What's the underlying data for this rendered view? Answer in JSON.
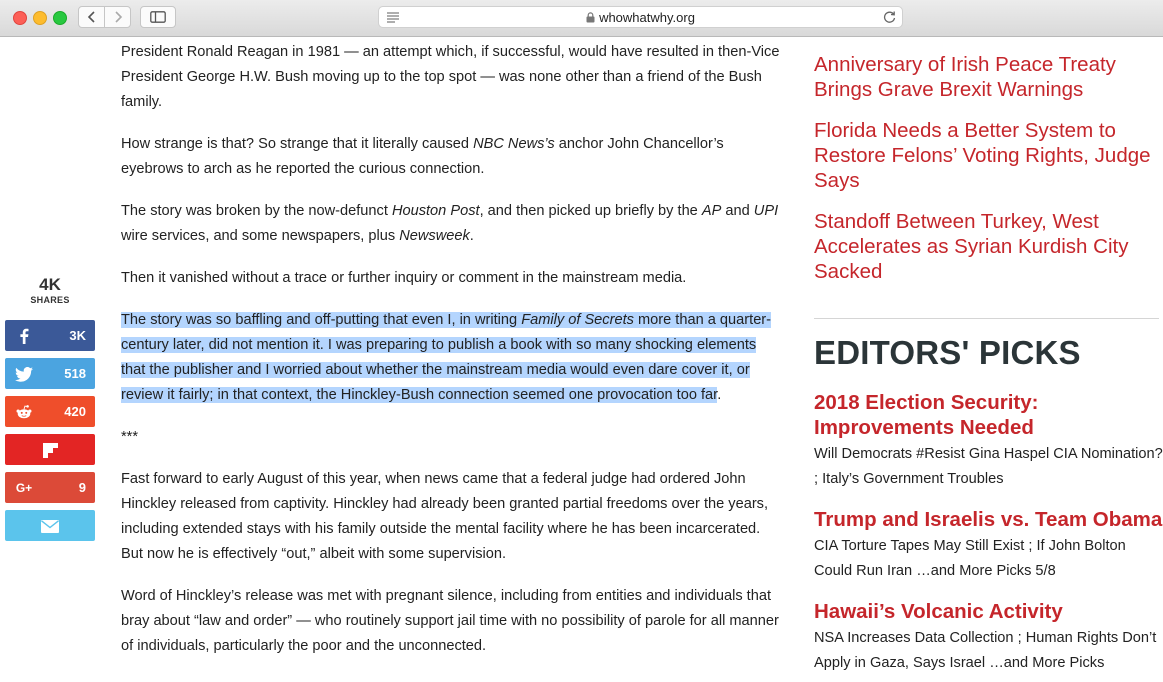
{
  "browser": {
    "url": "whowhatwhy.org"
  },
  "article": {
    "paragraphs": [
      {
        "runs": [
          {
            "t": "President Ronald Reagan in 1981 — an attempt which, if successful, would have resulted in then-Vice President George H.W. Bush moving up to the top spot — was none other than a friend of the Bush family."
          }
        ]
      },
      {
        "runs": [
          {
            "t": "How strange is that? So strange that it literally caused "
          },
          {
            "t": "NBC News’s",
            "i": true
          },
          {
            "t": " anchor John Chancellor’s eyebrows to arch as he reported the curious connection."
          }
        ]
      },
      {
        "runs": [
          {
            "t": "The story was broken by the now-defunct "
          },
          {
            "t": "Houston Post",
            "i": true
          },
          {
            "t": ", and then picked up briefly by the "
          },
          {
            "t": "AP",
            "i": true
          },
          {
            "t": " and "
          },
          {
            "t": "UPI",
            "i": true
          },
          {
            "t": " wire services, and some newspapers, plus "
          },
          {
            "t": "Newsweek",
            "i": true
          },
          {
            "t": "."
          }
        ]
      },
      {
        "runs": [
          {
            "t": "Then it vanished without a trace or further inquiry or comment in the mainstream media."
          }
        ]
      },
      {
        "runs": [
          {
            "t": "The story was so baffling and off-putting that even I, in writing ",
            "h": true
          },
          {
            "t": "Family of Secrets",
            "i": true,
            "h": true
          },
          {
            "t": " more than a quarter-century later, did not mention it. I was preparing to publish a book with so many shocking elements that the publisher and I worried about whether the mainstream media would even dare cover it, or review it fairly; in that context, the Hinckley-Bush connection seemed one provocation too far",
            "h": true
          },
          {
            "t": "."
          }
        ]
      },
      {
        "runs": [
          {
            "t": "***"
          }
        ]
      },
      {
        "runs": [
          {
            "t": "Fast forward to early August of this year, when news came that a federal judge had ordered John Hinckley released from captivity. Hinckley had already been granted partial freedoms over the years, including extended stays with his family outside the mental facility where he has been incarcerated. But now he is effectively “out,” albeit with some supervision."
          }
        ]
      },
      {
        "runs": [
          {
            "t": "Word of Hinckley’s release was met with pregnant silence, including from entities and individuals that bray about “law and order” — who routinely support jail time with no possibility of parole for all manner of individuals, particularly the poor and the unconnected."
          }
        ]
      }
    ]
  },
  "share": {
    "total": "4K",
    "label": "SHARES",
    "buttons": [
      {
        "network": "facebook",
        "icon": "facebook-icon",
        "count": "3K"
      },
      {
        "network": "twitter",
        "icon": "twitter-icon",
        "count": "518"
      },
      {
        "network": "reddit",
        "icon": "reddit-icon",
        "count": "420"
      },
      {
        "network": "flipboard",
        "icon": "flipboard-icon",
        "count": ""
      },
      {
        "network": "google-plus",
        "icon": "google-plus-icon",
        "glyph": "G+",
        "count": "9"
      },
      {
        "network": "email",
        "icon": "email-icon",
        "count": ""
      }
    ]
  },
  "sidebar": {
    "related": [
      "Anniversary of Irish Peace Treaty Brings Grave Brexit Warnings",
      "Florida Needs a Better System to Restore Felons’ Voting Rights, Judge Says",
      "Standoff Between Turkey, West Accelerates as Syrian Kurdish City Sacked"
    ],
    "editors_title": "EDITORS' PICKS",
    "picks": [
      {
        "title": "2018 Election Security: Improvements Needed",
        "desc": "Will Democrats #Resist Gina Haspel CIA Nomination? ; Italy’s Government Troubles"
      },
      {
        "title": "Trump and Israelis vs. Team Obama",
        "desc": "CIA Torture Tapes May Still Exist ; If John Bolton Could Run Iran …and More Picks 5/8"
      },
      {
        "title": "Hawaii’s Volcanic Activity",
        "desc": "NSA Increases Data Collection ; Human Rights Don’t Apply in Gaza, Says Israel …and More Picks"
      }
    ]
  },
  "colors": {
    "link_red": "#c5262b",
    "selection": "#b4d5fe",
    "facebook": "#3b5998",
    "twitter": "#4ba4e0",
    "reddit": "#ef4e2b",
    "flipboard": "#e32524",
    "google_plus": "#dc4a38",
    "email": "#5bc4ec"
  }
}
